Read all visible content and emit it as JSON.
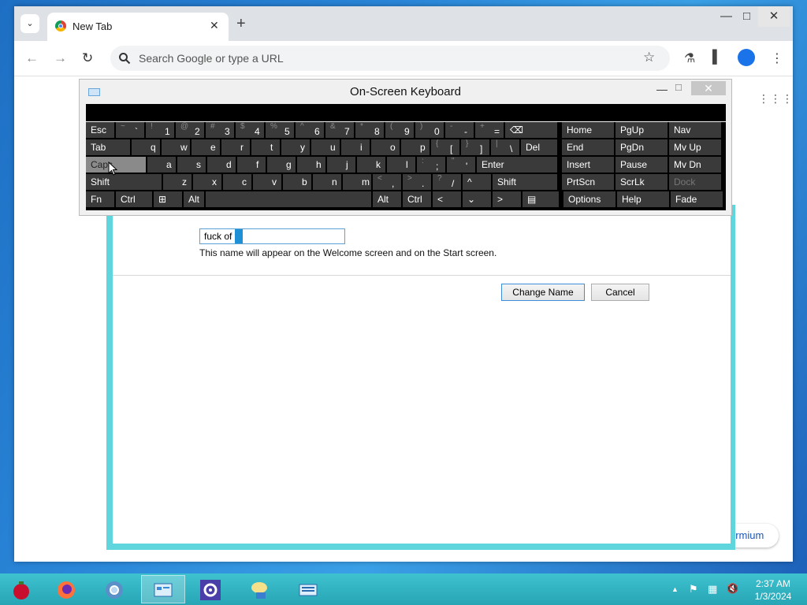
{
  "browser": {
    "tab_list_glyph": "⌄",
    "tab_title": "New Tab",
    "tab_close": "✕",
    "new_tab": "+",
    "minimize": "—",
    "maximize": "□",
    "close": "✕",
    "omnibox_placeholder": "Search Google or type a URL",
    "back_glyph": "←",
    "forward_glyph": "→",
    "reload_glyph": "↻",
    "star_glyph": "☆",
    "labs_glyph": "⚗",
    "sidepanel_glyph": "▌",
    "menu_glyph": "⋮",
    "apps_glyph": "⋮⋮⋮",
    "customize_partial": "ermium",
    "search_icon": "search-icon"
  },
  "osk": {
    "title": "On-Screen Keyboard",
    "minimize": "—",
    "maximize": "□",
    "close": "✕",
    "rows": [
      [
        {
          "name": "esc",
          "label": "Esc",
          "w": 36
        },
        {
          "name": "backquote",
          "shift": "~",
          "main": "`"
        },
        {
          "name": "1",
          "shift": "!",
          "main": "1"
        },
        {
          "name": "2",
          "shift": "@",
          "main": "2"
        },
        {
          "name": "3",
          "shift": "#",
          "main": "3"
        },
        {
          "name": "4",
          "shift": "$",
          "main": "4"
        },
        {
          "name": "5",
          "shift": "%",
          "main": "5"
        },
        {
          "name": "6",
          "shift": "^",
          "main": "6"
        },
        {
          "name": "7",
          "shift": "&",
          "main": "7"
        },
        {
          "name": "8",
          "shift": "*",
          "main": "8"
        },
        {
          "name": "9",
          "shift": "(",
          "main": "9"
        },
        {
          "name": "0",
          "shift": ")",
          "main": "0"
        },
        {
          "name": "minus",
          "shift": "-",
          "main": "-"
        },
        {
          "name": "equals",
          "shift": "+",
          "main": "="
        },
        {
          "name": "backspace",
          "label": "⌫",
          "w": 66
        },
        {
          "gap": 4
        },
        {
          "name": "home",
          "label": "Home",
          "w": 66
        },
        {
          "name": "pgup",
          "label": "PgUp",
          "w": 66
        },
        {
          "name": "nav",
          "label": "Nav",
          "w": 66
        }
      ],
      [
        {
          "name": "tab",
          "label": "Tab",
          "w": 56
        },
        {
          "name": "q",
          "main": "q"
        },
        {
          "name": "w",
          "main": "w"
        },
        {
          "name": "e",
          "main": "e"
        },
        {
          "name": "r",
          "main": "r"
        },
        {
          "name": "t",
          "main": "t"
        },
        {
          "name": "y",
          "main": "y"
        },
        {
          "name": "u",
          "main": "u"
        },
        {
          "name": "i",
          "main": "i"
        },
        {
          "name": "o",
          "main": "o"
        },
        {
          "name": "p",
          "main": "p"
        },
        {
          "name": "bracket-left",
          "shift": "{",
          "main": "["
        },
        {
          "name": "bracket-right",
          "shift": "}",
          "main": "]"
        },
        {
          "name": "backslash",
          "shift": "|",
          "main": "\\"
        },
        {
          "name": "del",
          "label": "Del",
          "w": 46
        },
        {
          "gap": 4
        },
        {
          "name": "end",
          "label": "End",
          "w": 66
        },
        {
          "name": "pgdn",
          "label": "PgDn",
          "w": 66
        },
        {
          "name": "mvup",
          "label": "Mv Up",
          "w": 66
        }
      ],
      [
        {
          "name": "caps",
          "label": "Caps",
          "w": 76,
          "active": true
        },
        {
          "name": "a",
          "main": "a"
        },
        {
          "name": "s",
          "main": "s"
        },
        {
          "name": "d",
          "main": "d"
        },
        {
          "name": "f",
          "main": "f"
        },
        {
          "name": "g",
          "main": "g"
        },
        {
          "name": "h",
          "main": "h"
        },
        {
          "name": "j",
          "main": "j"
        },
        {
          "name": "k",
          "main": "k"
        },
        {
          "name": "l",
          "main": "l"
        },
        {
          "name": "semicolon",
          "shift": ":",
          "main": ";"
        },
        {
          "name": "quote",
          "shift": "\"",
          "main": "'"
        },
        {
          "name": "enter",
          "label": "Enter",
          "w": 102
        },
        {
          "gap": 4
        },
        {
          "name": "insert",
          "label": "Insert",
          "w": 66
        },
        {
          "name": "pause",
          "label": "Pause",
          "w": 66
        },
        {
          "name": "mvdn",
          "label": "Mv Dn",
          "w": 66
        }
      ],
      [
        {
          "name": "shift-left",
          "label": "Shift",
          "w": 96
        },
        {
          "name": "z",
          "main": "z"
        },
        {
          "name": "x",
          "main": "x"
        },
        {
          "name": "c",
          "main": "c"
        },
        {
          "name": "v",
          "main": "v"
        },
        {
          "name": "b",
          "main": "b"
        },
        {
          "name": "n",
          "main": "n"
        },
        {
          "name": "m",
          "main": "m"
        },
        {
          "name": "comma",
          "shift": "<",
          "main": ","
        },
        {
          "name": "period",
          "shift": ">",
          "main": "."
        },
        {
          "name": "slash",
          "shift": "?",
          "main": "/"
        },
        {
          "name": "up",
          "label": "^",
          "w": 36
        },
        {
          "name": "shift-right",
          "label": "Shift",
          "w": 82
        },
        {
          "gap": 4
        },
        {
          "name": "prtscn",
          "label": "PrtScn",
          "w": 66
        },
        {
          "name": "scrlk",
          "label": "ScrLk",
          "w": 66
        },
        {
          "name": "dock",
          "label": "Dock",
          "w": 66,
          "dim": true
        }
      ],
      [
        {
          "name": "fn",
          "label": "Fn",
          "w": 36
        },
        {
          "name": "ctrl-left",
          "label": "Ctrl",
          "w": 46
        },
        {
          "name": "win",
          "label": "⊞",
          "w": 36
        },
        {
          "name": "alt-left",
          "label": "Alt",
          "w": 26
        },
        {
          "name": "space",
          "label": "",
          "w": 210
        },
        {
          "name": "alt-right",
          "label": "Alt",
          "w": 36
        },
        {
          "name": "ctrl-right",
          "label": "Ctrl",
          "w": 36
        },
        {
          "name": "left",
          "label": "<",
          "w": 36
        },
        {
          "name": "down",
          "label": "⌄",
          "w": 36
        },
        {
          "name": "right",
          "label": ">",
          "w": 36
        },
        {
          "name": "menu",
          "label": "▤",
          "w": 46
        },
        {
          "gap": 4
        },
        {
          "name": "options",
          "label": "Options",
          "w": 66
        },
        {
          "name": "help",
          "label": "Help",
          "w": 66
        },
        {
          "name": "fade",
          "label": "Fade",
          "w": 66
        }
      ]
    ]
  },
  "dialog": {
    "name_value": "fuck of f",
    "hint": "This name will appear on the Welcome screen and on the Start screen.",
    "change_label": "Change Name",
    "cancel_label": "Cancel"
  },
  "taskbar": {
    "time": "2:37 AM",
    "date": "1/3/2024",
    "tray_up": "▲",
    "tray_flag": "⚑",
    "tray_network": "▦",
    "tray_volume": "🔇"
  }
}
